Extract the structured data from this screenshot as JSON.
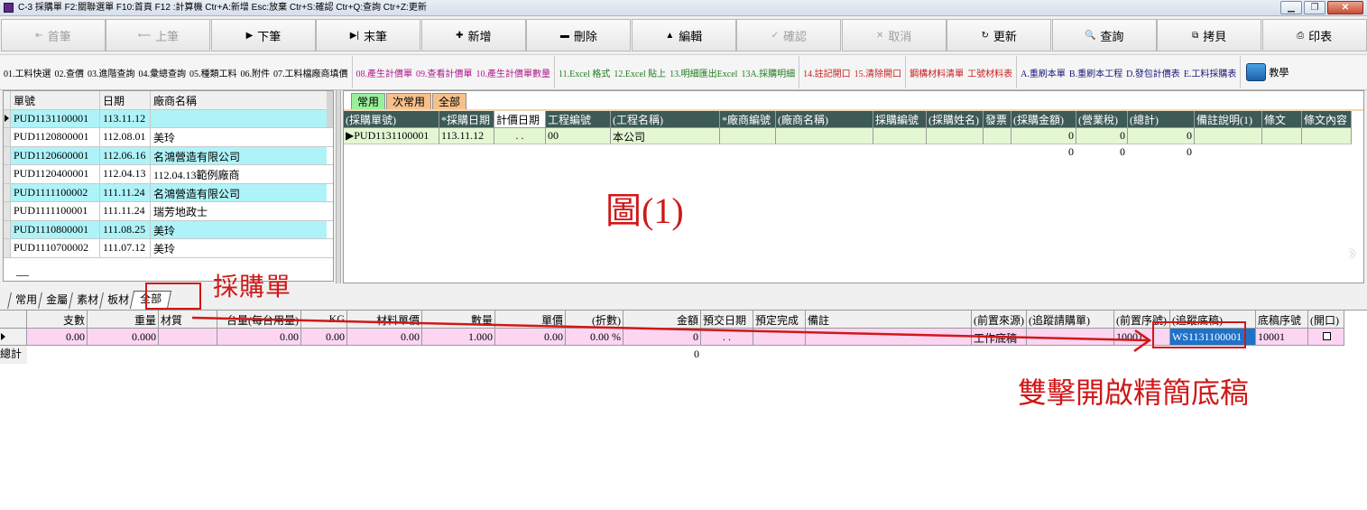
{
  "titlebar": {
    "text": "C-3 採購單   F2:關聯選單  F10:首頁   F12 :計算機  Ctr+A:新增  Esc:放棄  Ctr+S:確認  Ctr+Q:查詢  Ctr+Z:更新",
    "minimize": "▁",
    "restore": "❐",
    "close": "✕"
  },
  "nav": {
    "first": "首筆",
    "prev": "上筆",
    "next": "下筆",
    "last": "末筆",
    "add": "新增",
    "delete": "刪除",
    "edit": "編輯",
    "confirm": "確認",
    "cancel": "取消",
    "refresh": "更新",
    "query": "查詢",
    "copy": "拷貝",
    "print": "印表"
  },
  "functions": {
    "g1": [
      "01.工料快選",
      "02.查價",
      "03.進階查詢",
      "04.彙總查詢",
      "05.種類工料",
      "06.附件",
      "07.工料檔廠商填價"
    ],
    "g2": [
      "08.產生計價單",
      "09.查看計價單",
      "10.產生計價單數量"
    ],
    "g3": [
      "11.Excel 格式",
      "12.Excel 貼上",
      "13.明細匯出Excel",
      "13A.採購明細"
    ],
    "g4": [
      "14.註記開口",
      "15.清除開口"
    ],
    "g5": [
      "鋼構材料清單",
      "工號材料表"
    ],
    "g6": [
      "A.重刷本單",
      "B.重刷本工程",
      "D.發包計價表",
      "E.工料採購表"
    ],
    "teach": "教學"
  },
  "left_grid": {
    "headers": [
      "單號",
      "日期",
      "廠商名稱"
    ],
    "rows": [
      {
        "no": "PUD1131100001",
        "date": "113.11.12",
        "vendor": ""
      },
      {
        "no": "PUD1120800001",
        "date": "112.08.01",
        "vendor": "美玲"
      },
      {
        "no": "PUD1120600001",
        "date": "112.06.16",
        "vendor": "名鴻營造有限公司"
      },
      {
        "no": "PUD1120400001",
        "date": "112.04.13",
        "vendor": "112.04.13範例廠商"
      },
      {
        "no": "PUD1111100002",
        "date": "111.11.24",
        "vendor": "名鴻營造有限公司"
      },
      {
        "no": "PUD1111100001",
        "date": "111.11.24",
        "vendor": "瑞芳地政士"
      },
      {
        "no": "PUD1110800001",
        "date": "111.08.25",
        "vendor": "美玲"
      },
      {
        "no": "PUD1110700002",
        "date": "111.07.12",
        "vendor": "美玲"
      }
    ]
  },
  "right_panel": {
    "tabs": [
      "常用",
      "次常用",
      "全部"
    ],
    "headers": [
      "(採購單號)",
      "*採購日期",
      "計價日期",
      "工程編號",
      "(工程名稱)",
      "*廠商編號",
      "(廠商名稱)",
      "採購編號",
      "(採購姓名)",
      "發票",
      "(採購金額)",
      "(營業稅)",
      "(總計)",
      "備註說明(1)",
      "條文",
      "條文內容"
    ],
    "row": {
      "no": "PUD1131100001",
      "date": "113.11.12",
      "price_date": ". .",
      "project_no": "00",
      "project_name": "本公司",
      "amount": "0",
      "tax": "0",
      "total": "0"
    },
    "totals": {
      "amount": "0",
      "tax": "0",
      "total": "0"
    },
    "figure_label": "圖(1)",
    "chevron": "›"
  },
  "bottom_tabs": [
    "常用",
    "金屬",
    "素材",
    "板材",
    "全部"
  ],
  "bottom_grid": {
    "headers": [
      "支數",
      "重量",
      "材質",
      "台量(每台用量)",
      "KG",
      "材料單價",
      "數量",
      "單價",
      "(折數)",
      "金額",
      "預交日期",
      "預定完成",
      "備註",
      "(前置來源)",
      "(追蹤請購單)",
      "(前置序號)",
      "(追蹤底稿)",
      "底稿序號",
      "(開口)"
    ],
    "row": {
      "pieces": "0.00",
      "weight": "0.000",
      "material": "",
      "unit_qty": "0.00",
      "kg": "0.00",
      "mat_price": "0.00",
      "qty": "1.000",
      "price": "0.00",
      "discount": "0.00 %",
      "amount": "0",
      "due": ". .",
      "source": "工作底稿",
      "pre_seq": "10001",
      "track_draft": "WS1131100001",
      "draft_seq": "10001"
    },
    "total_label": "總計",
    "total_amount": "0"
  },
  "annotations": {
    "tab_note": "採購單",
    "cell_note": "雙擊開啟精簡底稿"
  },
  "colors": {
    "annotation": "#d01818",
    "left_row_highlight": "#aef3f8",
    "right_header": "#3d5a56",
    "right_row": "#e4f7d3",
    "bottom_row": "#fbd5f2",
    "selected_cell": "#1f72c8",
    "tab_active": "#98f19a",
    "tab_orange": "#f7c08b"
  }
}
